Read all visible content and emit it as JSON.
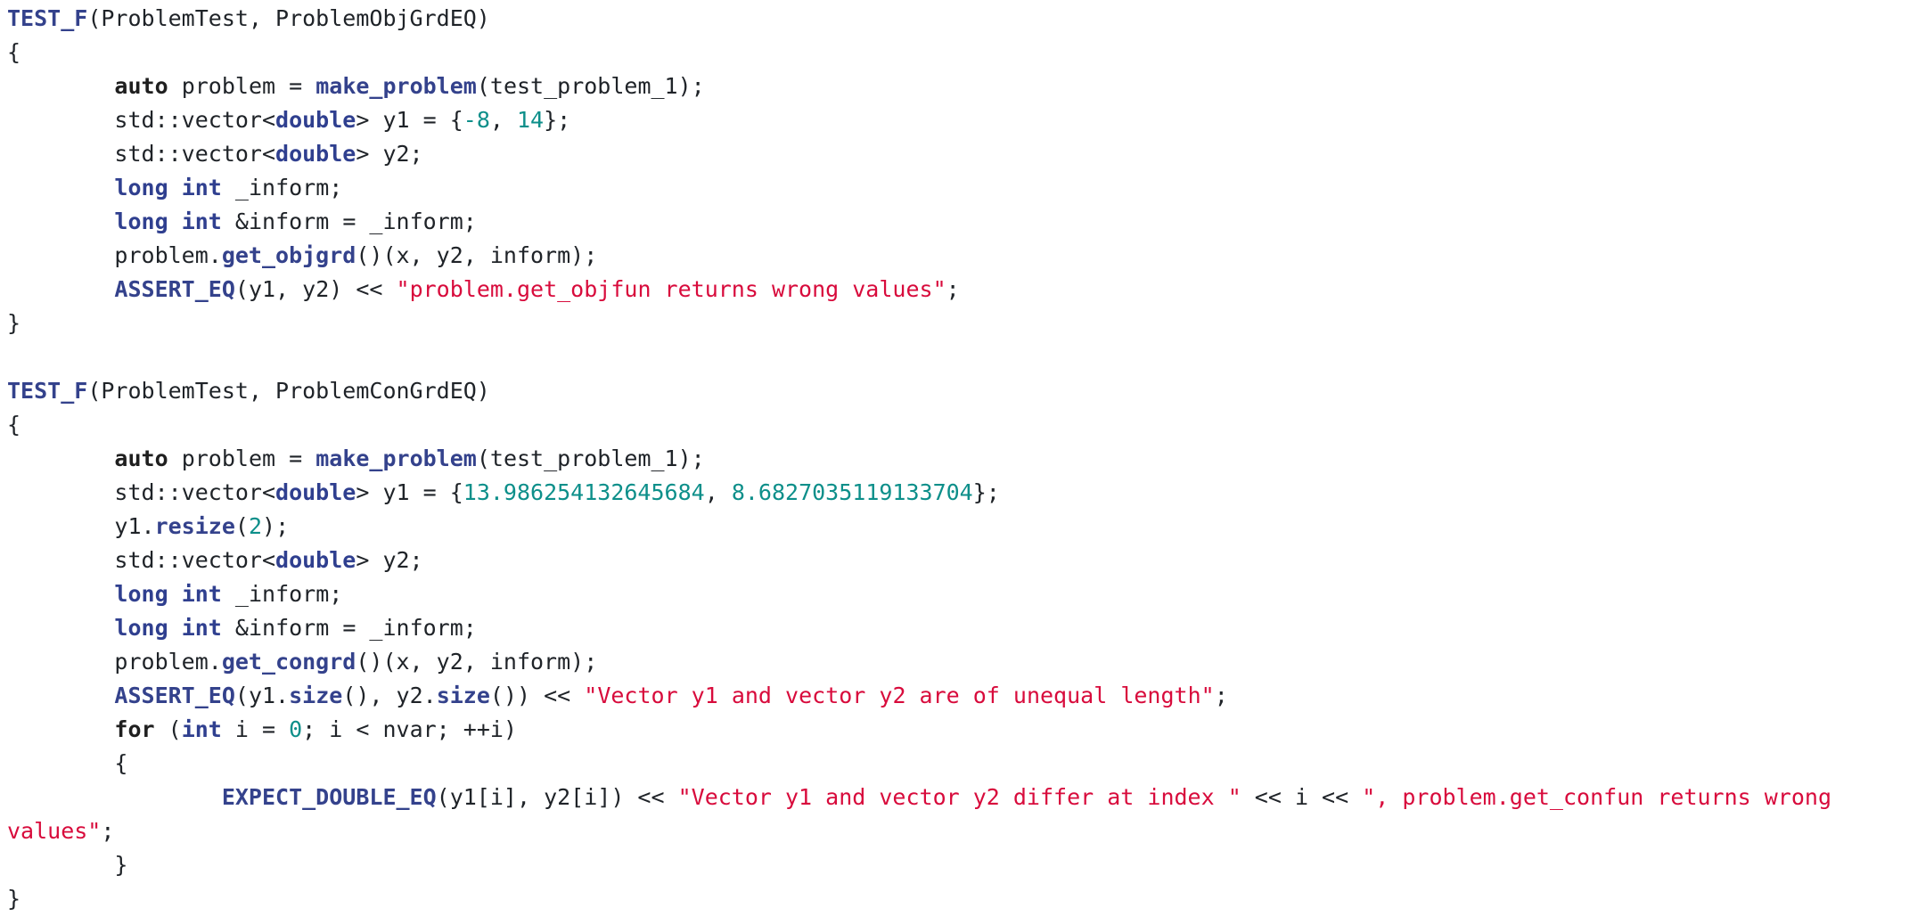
{
  "editor": {
    "lines": [
      [
        {
          "text": "TEST_F",
          "kind": "macro"
        },
        {
          "text": "(ProblemTest, ProblemObjGrdEQ)",
          "kind": "text"
        }
      ],
      [
        {
          "text": "{",
          "kind": "text"
        }
      ],
      [
        {
          "text": "        ",
          "kind": "text"
        },
        {
          "text": "auto",
          "kind": "keyword"
        },
        {
          "text": " problem = ",
          "kind": "text"
        },
        {
          "text": "make_problem",
          "kind": "call"
        },
        {
          "text": "(test_problem_1);",
          "kind": "text"
        }
      ],
      [
        {
          "text": "        std::vector<",
          "kind": "text"
        },
        {
          "text": "double",
          "kind": "type"
        },
        {
          "text": "> y1 = {",
          "kind": "text"
        },
        {
          "text": "-8",
          "kind": "number"
        },
        {
          "text": ", ",
          "kind": "text"
        },
        {
          "text": "14",
          "kind": "number"
        },
        {
          "text": "};",
          "kind": "text"
        }
      ],
      [
        {
          "text": "        std::vector<",
          "kind": "text"
        },
        {
          "text": "double",
          "kind": "type"
        },
        {
          "text": "> y2;",
          "kind": "text"
        }
      ],
      [
        {
          "text": "        ",
          "kind": "text"
        },
        {
          "text": "long",
          "kind": "type"
        },
        {
          "text": " ",
          "kind": "text"
        },
        {
          "text": "int",
          "kind": "type"
        },
        {
          "text": " _inform;",
          "kind": "text"
        }
      ],
      [
        {
          "text": "        ",
          "kind": "text"
        },
        {
          "text": "long",
          "kind": "type"
        },
        {
          "text": " ",
          "kind": "text"
        },
        {
          "text": "int",
          "kind": "type"
        },
        {
          "text": " &inform = _inform;",
          "kind": "text"
        }
      ],
      [
        {
          "text": "        problem.",
          "kind": "text"
        },
        {
          "text": "get_objgrd",
          "kind": "call"
        },
        {
          "text": "()(x, y2, inform);",
          "kind": "text"
        }
      ],
      [
        {
          "text": "        ",
          "kind": "text"
        },
        {
          "text": "ASSERT_EQ",
          "kind": "macro"
        },
        {
          "text": "(y1, y2) << ",
          "kind": "text"
        },
        {
          "text": "\"problem.get_objfun returns wrong values\"",
          "kind": "string"
        },
        {
          "text": ";",
          "kind": "text"
        }
      ],
      [
        {
          "text": "}",
          "kind": "text"
        }
      ],
      [],
      [
        {
          "text": "TEST_F",
          "kind": "macro"
        },
        {
          "text": "(ProblemTest, ProblemConGrdEQ)",
          "kind": "text"
        }
      ],
      [
        {
          "text": "{",
          "kind": "text"
        }
      ],
      [
        {
          "text": "        ",
          "kind": "text"
        },
        {
          "text": "auto",
          "kind": "keyword"
        },
        {
          "text": " problem = ",
          "kind": "text"
        },
        {
          "text": "make_problem",
          "kind": "call"
        },
        {
          "text": "(test_problem_1);",
          "kind": "text"
        }
      ],
      [
        {
          "text": "        std::vector<",
          "kind": "text"
        },
        {
          "text": "double",
          "kind": "type"
        },
        {
          "text": "> y1 = {",
          "kind": "text"
        },
        {
          "text": "13.986254132645684",
          "kind": "number"
        },
        {
          "text": ", ",
          "kind": "text"
        },
        {
          "text": "8.6827035119133704",
          "kind": "number"
        },
        {
          "text": "};",
          "kind": "text"
        }
      ],
      [
        {
          "text": "        y1.",
          "kind": "text"
        },
        {
          "text": "resize",
          "kind": "call"
        },
        {
          "text": "(",
          "kind": "text"
        },
        {
          "text": "2",
          "kind": "number"
        },
        {
          "text": ");",
          "kind": "text"
        }
      ],
      [
        {
          "text": "        std::vector<",
          "kind": "text"
        },
        {
          "text": "double",
          "kind": "type"
        },
        {
          "text": "> y2;",
          "kind": "text"
        }
      ],
      [
        {
          "text": "        ",
          "kind": "text"
        },
        {
          "text": "long",
          "kind": "type"
        },
        {
          "text": " ",
          "kind": "text"
        },
        {
          "text": "int",
          "kind": "type"
        },
        {
          "text": " _inform;",
          "kind": "text"
        }
      ],
      [
        {
          "text": "        ",
          "kind": "text"
        },
        {
          "text": "long",
          "kind": "type"
        },
        {
          "text": " ",
          "kind": "text"
        },
        {
          "text": "int",
          "kind": "type"
        },
        {
          "text": " &inform = _inform;",
          "kind": "text"
        }
      ],
      [
        {
          "text": "        problem.",
          "kind": "text"
        },
        {
          "text": "get_congrd",
          "kind": "call"
        },
        {
          "text": "()(x, y2, inform);",
          "kind": "text"
        }
      ],
      [
        {
          "text": "        ",
          "kind": "text"
        },
        {
          "text": "ASSERT_EQ",
          "kind": "macro"
        },
        {
          "text": "(y1.",
          "kind": "text"
        },
        {
          "text": "size",
          "kind": "call"
        },
        {
          "text": "(), y2.",
          "kind": "text"
        },
        {
          "text": "size",
          "kind": "call"
        },
        {
          "text": "()) << ",
          "kind": "text"
        },
        {
          "text": "\"Vector y1 and vector y2 are of unequal length\"",
          "kind": "string"
        },
        {
          "text": ";",
          "kind": "text"
        }
      ],
      [
        {
          "text": "        ",
          "kind": "text"
        },
        {
          "text": "for",
          "kind": "keyword"
        },
        {
          "text": " (",
          "kind": "text"
        },
        {
          "text": "int",
          "kind": "type"
        },
        {
          "text": " i = ",
          "kind": "text"
        },
        {
          "text": "0",
          "kind": "number"
        },
        {
          "text": "; i < nvar; ++i)",
          "kind": "text"
        }
      ],
      [
        {
          "text": "        {",
          "kind": "text"
        }
      ],
      [
        {
          "text": "                ",
          "kind": "text"
        },
        {
          "text": "EXPECT_DOUBLE_EQ",
          "kind": "macro"
        },
        {
          "text": "(y1[i], y2[i]) << ",
          "kind": "text"
        },
        {
          "text": "\"Vector y1 and vector y2 differ at index \"",
          "kind": "string"
        },
        {
          "text": " << i << ",
          "kind": "text"
        },
        {
          "text": "\", problem.get_confun returns wrong",
          "kind": "string"
        }
      ],
      [
        {
          "text": "values\"",
          "kind": "string"
        },
        {
          "text": ";",
          "kind": "text"
        }
      ],
      [
        {
          "text": "        }",
          "kind": "text"
        }
      ],
      [
        {
          "text": "}",
          "kind": "text"
        }
      ]
    ]
  }
}
